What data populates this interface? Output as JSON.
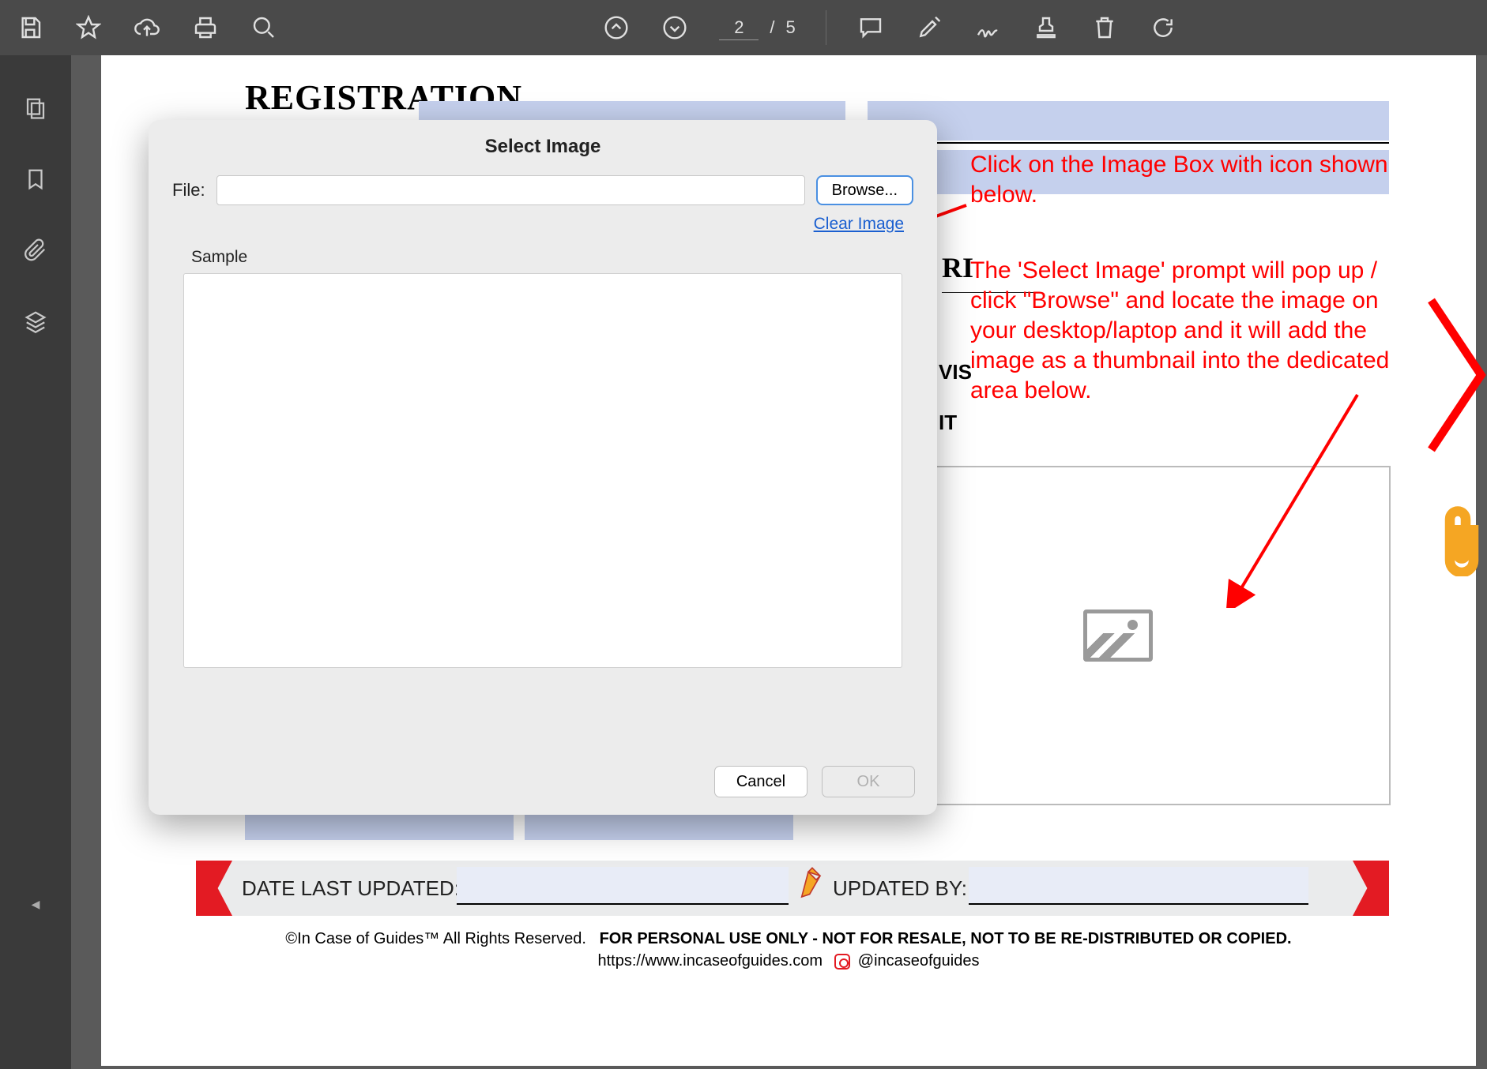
{
  "toolbar": {
    "page_current": "2",
    "page_total": "5"
  },
  "document": {
    "title": "REGISTRATION",
    "fragment_heading": "RI",
    "fragment_vis": "VIS",
    "fragment_it": "IT",
    "date_last_updated_label": "DATE LAST UPDATED:",
    "updated_by_label": "UPDATED BY:",
    "copyright_a": "©In Case of Guides™  All Rights Reserved.",
    "copyright_b": "FOR PERSONAL USE ONLY - NOT FOR RESALE, NOT TO BE RE-DISTRIBUTED OR COPIED.",
    "url": "https://www.incaseofguides.com",
    "handle": "@incaseofguides"
  },
  "dialog": {
    "title": "Select Image",
    "file_label": "File:",
    "file_value": "",
    "browse": "Browse...",
    "clear": "Clear Image",
    "sample_label": "Sample",
    "cancel": "Cancel",
    "ok": "OK"
  },
  "annotation": {
    "line1": "Click on the Image Box with icon shown below.",
    "line2": "The 'Select Image' prompt will pop up / click \"Browse\" and locate the image on your desktop/laptop and it will add the image as a thumbnail into the dedicated area below."
  }
}
